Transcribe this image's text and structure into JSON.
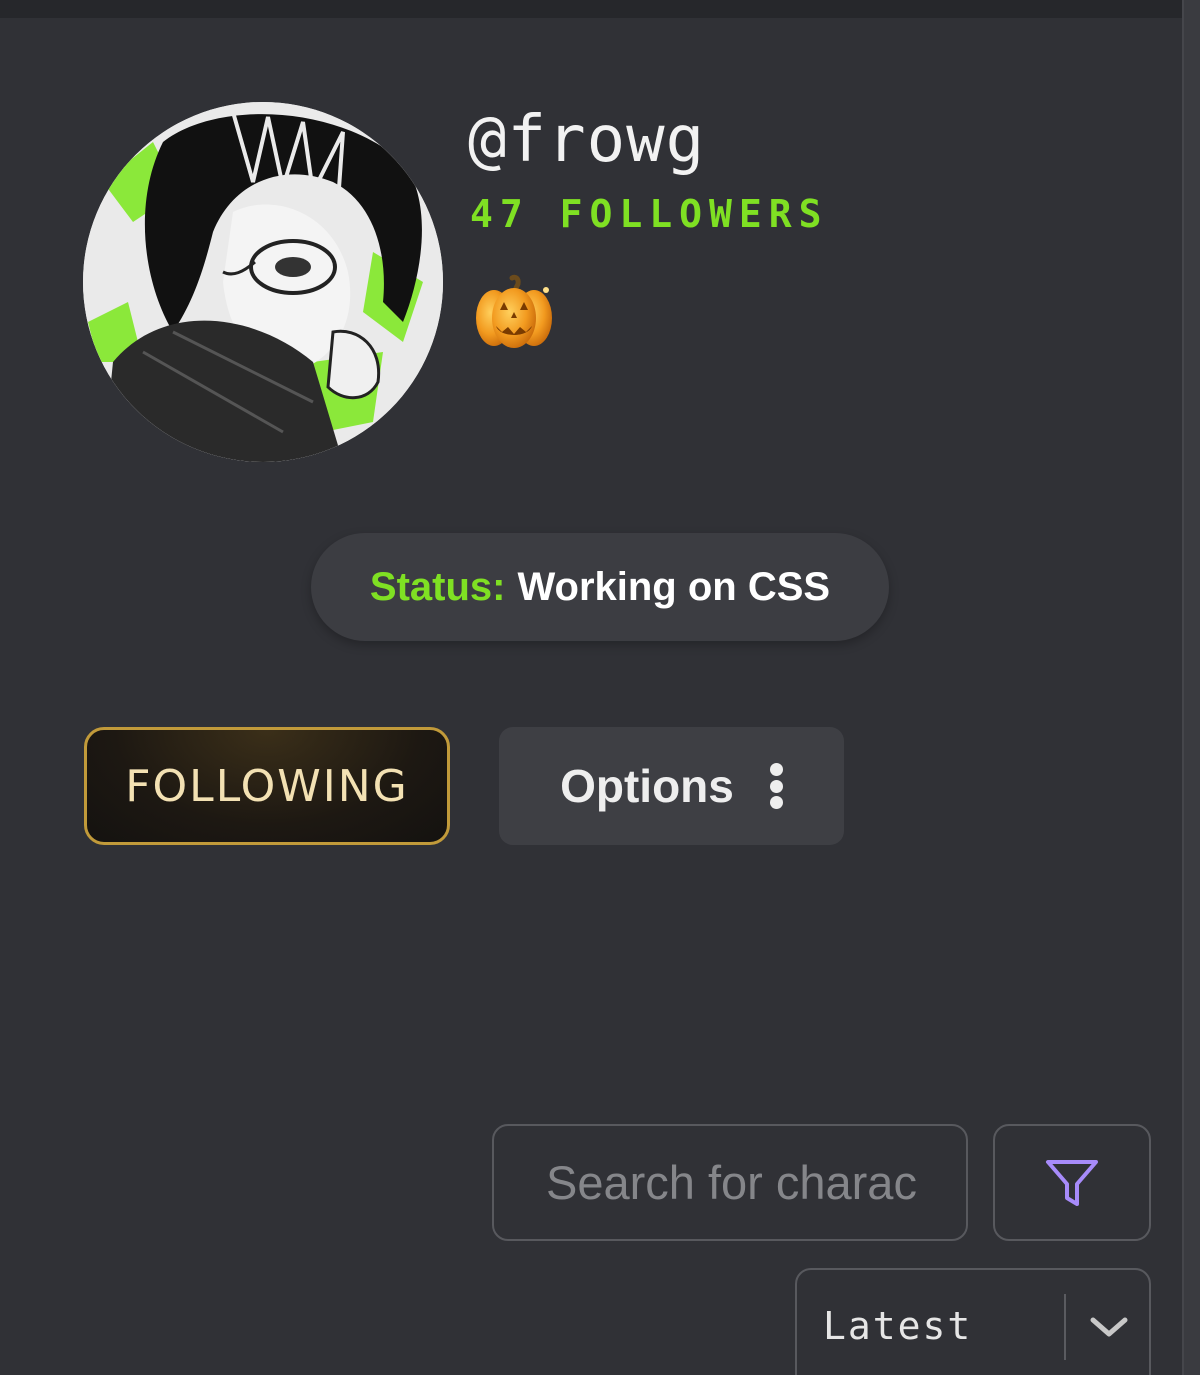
{
  "profile": {
    "username": "@frowg",
    "followers_text": "47 FOLLOWERS",
    "badge_emoji": "🎃",
    "avatar_icon": "anime-girl-avatar"
  },
  "status": {
    "label": "Status:",
    "value": "Working on CSS",
    "label_color": "#7fe023"
  },
  "actions": {
    "following_label": "FOLLOWING",
    "options_label": "Options"
  },
  "search": {
    "placeholder": "Search for charac",
    "filter_icon": "filter-funnel-icon",
    "filter_icon_color": "#a78bfa"
  },
  "sort": {
    "selected": "Latest",
    "chevron_icon": "chevron-down-icon"
  },
  "colors": {
    "background": "#303136",
    "accent_green": "#7fe023",
    "gold_border": "#c19a3a"
  }
}
